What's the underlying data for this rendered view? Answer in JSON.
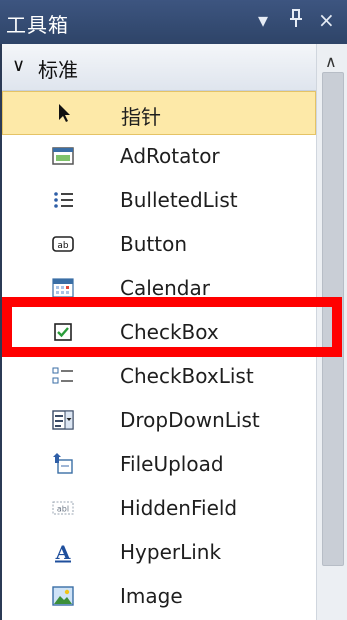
{
  "window": {
    "title": "工具箱",
    "dropdown_icon": "▾",
    "pin_icon": "ꟸ",
    "close_icon": "×"
  },
  "group": {
    "label": "标准",
    "chevron": "∨"
  },
  "items": [
    {
      "label": "指针",
      "icon": "pointer-icon"
    },
    {
      "label": "AdRotator",
      "icon": "adrotator-icon"
    },
    {
      "label": "BulletedList",
      "icon": "bulleted-list-icon"
    },
    {
      "label": "Button",
      "icon": "button-icon"
    },
    {
      "label": "Calendar",
      "icon": "calendar-icon"
    },
    {
      "label": "CheckBox",
      "icon": "checkbox-icon"
    },
    {
      "label": "CheckBoxList",
      "icon": "checkbox-list-icon"
    },
    {
      "label": "DropDownList",
      "icon": "dropdown-list-icon"
    },
    {
      "label": "FileUpload",
      "icon": "file-upload-icon"
    },
    {
      "label": "HiddenField",
      "icon": "hidden-field-icon"
    },
    {
      "label": "HyperLink",
      "icon": "hyperlink-icon"
    },
    {
      "label": "Image",
      "icon": "image-icon"
    }
  ],
  "colors": {
    "selected_bg": "#fde9a8",
    "highlight": "#ff0000"
  }
}
